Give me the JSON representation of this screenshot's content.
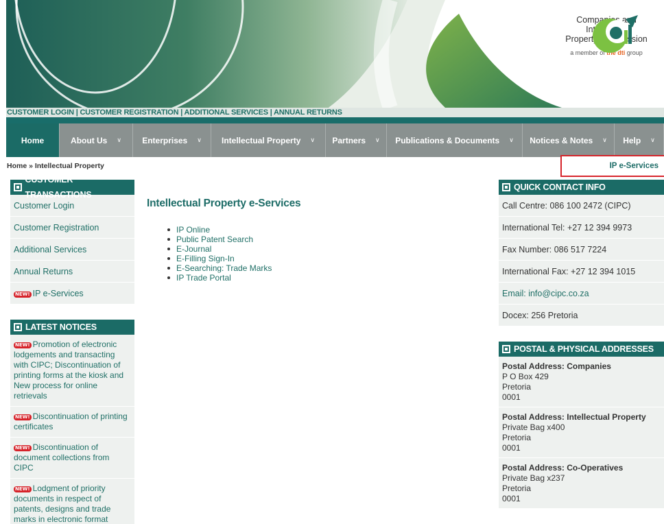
{
  "logo": {
    "org_name_line1": "Companies and Intellectual",
    "org_name_line2": "Property Commission",
    "member_prefix": "a member of ",
    "member_brand": "the dti",
    "member_suffix": " group",
    "icon": "cipc-logo-icon"
  },
  "toplinks": {
    "customer_login": "CUSTOMER LOGIN",
    "customer_registration": "CUSTOMER REGISTRATION",
    "additional_services": "ADDITIONAL SERVICES",
    "annual_returns": "ANNUAL RETURNS",
    "separator": " | "
  },
  "nav": {
    "items": [
      {
        "label": "Home",
        "dropdown": false
      },
      {
        "label": "About Us",
        "dropdown": true
      },
      {
        "label": "Enterprises",
        "dropdown": true
      },
      {
        "label": "Intellectual Property",
        "dropdown": true
      },
      {
        "label": "Partners",
        "dropdown": true
      },
      {
        "label": "Publications & Documents",
        "dropdown": true
      },
      {
        "label": "Notices & Notes",
        "dropdown": true
      },
      {
        "label": "Help",
        "dropdown": true
      }
    ],
    "chevron_icon": "chevron-down-icon"
  },
  "breadcrumb": "Home » Intellectual Property",
  "ip_tab_label": "IP e-Services",
  "customer_transactions": {
    "title": "CUSTOMER TRANSACTIONS",
    "items": [
      "Customer Login",
      "Customer Registration",
      "Additional Services",
      "Annual Returns",
      "IP e-Services"
    ],
    "new_badge": "NEW!"
  },
  "latest_notices": {
    "title": "LATEST NOTICES",
    "items": [
      "Promotion of electronic lodgements and transacting with CIPC; Discontinuation of printing forms at the kiosk and New process for online retrievals",
      "Discontinuation of printing certificates",
      "Discontinuation of document collections from CIPC",
      "Lodgment of priority documents in respect of patents, designs and trade marks in electronic format"
    ]
  },
  "main": {
    "title": "Intellectual Property e-Services",
    "links": [
      "IP Online",
      "Public Patent Search",
      "E-Journal",
      "E-Filling Sign-In",
      "E-Searching: Trade Marks",
      "IP Trade Portal"
    ]
  },
  "quick_contact": {
    "title": "QUICK CONTACT INFO",
    "call_centre": "Call Centre: 086 100 2472 (CIPC)",
    "intl_tel": "International Tel: +27 12 394 9973",
    "fax": "Fax Number: 086 517 7224",
    "intl_fax": "International Fax: +27 12 394 1015",
    "email": "Email: info@cipc.co.za",
    "docex": "Docex: 256 Pretoria"
  },
  "addresses": {
    "title": "POSTAL & PHYSICAL ADDRESSES",
    "items": [
      {
        "label": "Postal Address: Companies",
        "line1": "P O Box 429",
        "line2": "Pretoria",
        "line3": "0001"
      },
      {
        "label": "Postal Address: Intellectual Property",
        "line1": "Private Bag x400",
        "line2": "Pretoria",
        "line3": "0001"
      },
      {
        "label": "Postal Address: Co-Operatives",
        "line1": "Private Bag x237",
        "line2": "Pretoria",
        "line3": "0001"
      }
    ]
  },
  "colors": {
    "brand_teal": "#1b6b66",
    "nav_gray": "#8a9190",
    "highlight_red": "#d6232a",
    "link": "#1f6f66"
  }
}
